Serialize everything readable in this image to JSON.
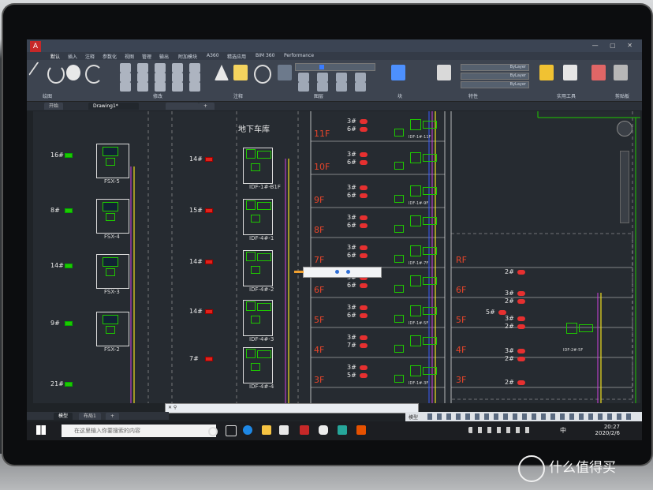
{
  "ribbon_tabs": [
    "默认",
    "插入",
    "注释",
    "参数化",
    "视图",
    "管理",
    "输出",
    "附加模块",
    "A360",
    "精选应用",
    "BIM 360",
    "Performance"
  ],
  "panel_labels": [
    "绘图",
    "修改",
    "注释",
    "图层",
    "块",
    "特性",
    "实用工具",
    "剪贴板"
  ],
  "layer_props": [
    "ByLayer",
    "ByLayer",
    "ByLayer"
  ],
  "doc_tabs": [
    "开始",
    "Drawing1*"
  ],
  "drawing": {
    "title": "地下车库",
    "col1": {
      "groups": [
        {
          "count": "16#",
          "name": "FSX-5"
        },
        {
          "count": "8#",
          "name": "FSX-4"
        },
        {
          "count": "14#",
          "name": "FSX-3"
        },
        {
          "count": "9#",
          "name": "FSX-2"
        },
        {
          "count": "21#",
          "name": ""
        }
      ]
    },
    "col2": {
      "groups": [
        {
          "count": "14#",
          "name": "IDF-1#-B1F"
        },
        {
          "count": "15#",
          "name": "IDF-4#-1"
        },
        {
          "count": "14#",
          "name": "IDF-4#-2"
        },
        {
          "count": "14#",
          "name": "IDF-4#-3"
        },
        {
          "count": "7#",
          "name": "IDF-4#-4"
        }
      ]
    },
    "floors": [
      "11F",
      "10F",
      "9F",
      "8F",
      "7F",
      "6F",
      "5F",
      "4F",
      "3F"
    ],
    "col3_counts": [
      [
        "3#",
        "6#"
      ],
      [
        "3#",
        "6#"
      ],
      [
        "3#",
        "6#"
      ],
      [
        "3#",
        "6#"
      ],
      [
        "3#",
        "6#"
      ],
      [
        "3#",
        "6#"
      ],
      [
        "3#",
        "6#"
      ],
      [
        "3#",
        "7#"
      ],
      [
        "3#",
        "5#"
      ]
    ],
    "col3_names": [
      "IDF-1#-11F",
      "",
      "IDF-1#-9F",
      "",
      "IDF-1#-7F",
      "",
      "IDF-1#-5F",
      "",
      "IDF-1#-3F"
    ],
    "col4_floors": [
      "RF",
      "6F",
      "5F",
      "4F",
      "3F"
    ],
    "col4_counts": [
      "2#",
      "3#",
      "2#",
      "5#",
      "3#",
      "2#",
      "3#",
      "2#",
      "2#"
    ],
    "col4_name": "IDF-2#-5F",
    "ups_label": "UPS"
  },
  "status": {
    "model_tab": "模型",
    "layout_tab": "布局1",
    "model_indicator": "模型"
  },
  "taskbar": {
    "search_placeholder": "在这里输入你要搜索的内容",
    "time": "20:27",
    "date": "2020/2/6",
    "ime": "中"
  },
  "watermark": "什么值得买",
  "colors": {
    "accent_red": "#e0231b",
    "line_green": "#1ec800",
    "line_yellow": "#f0e020",
    "line_magenta": "#d040e0",
    "line_blue": "#3a5cff"
  }
}
